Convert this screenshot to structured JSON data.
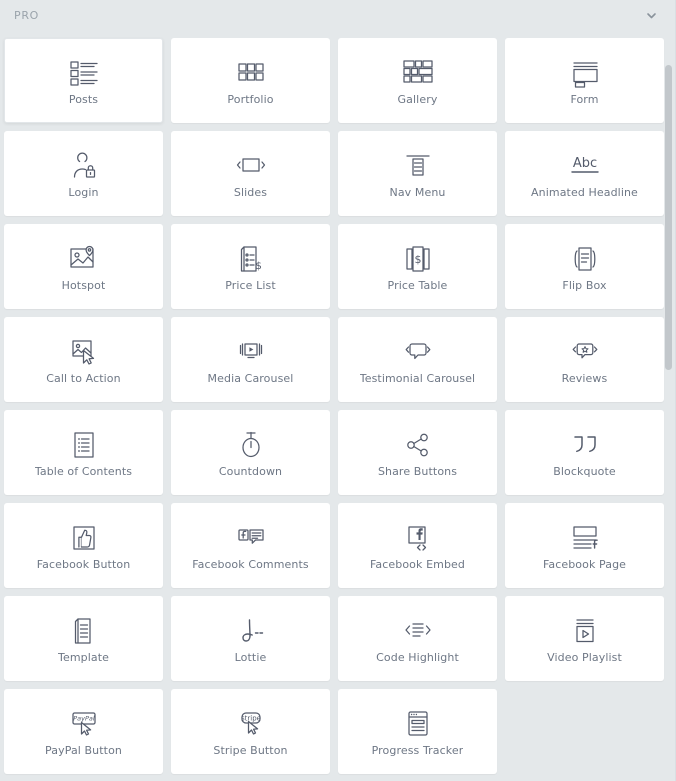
{
  "panel": {
    "section_title": "PRO",
    "toggle_icon": "chevron-down-icon",
    "background_color": "#e4e8ea",
    "card_color": "#ffffff",
    "label_color": "#6e7785",
    "icon_color": "#545b6b",
    "scrollbar_color": "#c2c7cb"
  },
  "widgets": [
    {
      "label": "Posts",
      "icon": "posts-icon",
      "hover": true
    },
    {
      "label": "Portfolio",
      "icon": "portfolio-icon",
      "hover": false
    },
    {
      "label": "Gallery",
      "icon": "gallery-icon",
      "hover": false
    },
    {
      "label": "Form",
      "icon": "form-icon",
      "hover": false
    },
    {
      "label": "Login",
      "icon": "login-icon",
      "hover": false
    },
    {
      "label": "Slides",
      "icon": "slides-icon",
      "hover": false
    },
    {
      "label": "Nav Menu",
      "icon": "nav-menu-icon",
      "hover": false
    },
    {
      "label": "Animated Headline",
      "icon": "animated-headline-icon",
      "hover": false
    },
    {
      "label": "Hotspot",
      "icon": "hotspot-icon",
      "hover": false
    },
    {
      "label": "Price List",
      "icon": "price-list-icon",
      "hover": false
    },
    {
      "label": "Price Table",
      "icon": "price-table-icon",
      "hover": false
    },
    {
      "label": "Flip Box",
      "icon": "flip-box-icon",
      "hover": false
    },
    {
      "label": "Call to Action",
      "icon": "call-to-action-icon",
      "hover": false
    },
    {
      "label": "Media Carousel",
      "icon": "media-carousel-icon",
      "hover": false
    },
    {
      "label": "Testimonial Carousel",
      "icon": "testimonial-carousel-icon",
      "hover": false
    },
    {
      "label": "Reviews",
      "icon": "reviews-icon",
      "hover": false
    },
    {
      "label": "Table of Contents",
      "icon": "table-of-contents-icon",
      "hover": false
    },
    {
      "label": "Countdown",
      "icon": "countdown-icon",
      "hover": false
    },
    {
      "label": "Share Buttons",
      "icon": "share-buttons-icon",
      "hover": false
    },
    {
      "label": "Blockquote",
      "icon": "blockquote-icon",
      "hover": false
    },
    {
      "label": "Facebook Button",
      "icon": "facebook-button-icon",
      "hover": false
    },
    {
      "label": "Facebook Comments",
      "icon": "facebook-comments-icon",
      "hover": false
    },
    {
      "label": "Facebook Embed",
      "icon": "facebook-embed-icon",
      "hover": false
    },
    {
      "label": "Facebook Page",
      "icon": "facebook-page-icon",
      "hover": false
    },
    {
      "label": "Template",
      "icon": "template-icon",
      "hover": false
    },
    {
      "label": "Lottie",
      "icon": "lottie-icon",
      "hover": false
    },
    {
      "label": "Code Highlight",
      "icon": "code-highlight-icon",
      "hover": false
    },
    {
      "label": "Video Playlist",
      "icon": "video-playlist-icon",
      "hover": false
    },
    {
      "label": "PayPal Button",
      "icon": "paypal-button-icon",
      "hover": false
    },
    {
      "label": "Stripe Button",
      "icon": "stripe-button-icon",
      "hover": false
    },
    {
      "label": "Progress Tracker",
      "icon": "progress-tracker-icon",
      "hover": false
    }
  ]
}
